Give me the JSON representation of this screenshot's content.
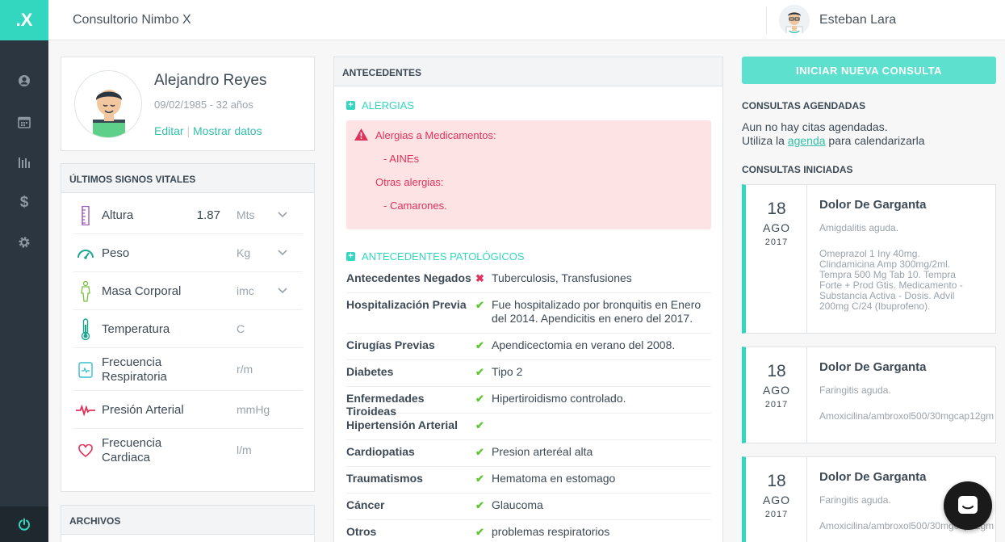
{
  "sidebar": {
    "logo": ".X"
  },
  "header": {
    "clinic_name": "Consultorio Nimbo X",
    "user_name": "Esteban Lara"
  },
  "patient": {
    "name": "Alejandro Reyes",
    "dob_age": "09/02/1985 - 32 años",
    "edit_label": "Editar",
    "separator": "|",
    "show_data_label": "Mostrar datos"
  },
  "vitals": {
    "title": "Últimos signos vitales",
    "items": [
      {
        "label": "Altura",
        "value": "1.87",
        "unit": "Mts",
        "icon": "ruler-icon"
      },
      {
        "label": "Peso",
        "value": "",
        "unit": "Kg",
        "icon": "scale-icon"
      },
      {
        "label": "Masa Corporal",
        "value": "",
        "unit": "imc",
        "icon": "body-icon"
      },
      {
        "label": "Temperatura",
        "value": "",
        "unit": "C",
        "icon": "thermometer-icon"
      },
      {
        "label": "Frecuencia Respiratoria",
        "value": "",
        "unit": "r/m",
        "icon": "lungs-monitor-icon"
      },
      {
        "label": "Presión Arterial",
        "value": "",
        "unit": "mmHg",
        "icon": "pulse-icon"
      },
      {
        "label": "Frecuencia Cardiaca",
        "value": "",
        "unit": "l/m",
        "icon": "heart-icon"
      }
    ]
  },
  "files": {
    "title": "Archivos"
  },
  "history": {
    "title": "Antecedentes",
    "allergies_title": "ALERGIAS",
    "allergy_med_title": "Alergias a Medicamentos:",
    "allergy_med_item": "- AINEs",
    "allergy_other_title": "Otras alergias:",
    "allergy_other_item": "- Camarones.",
    "pathological_title": "ANTECEDENTES PATOLÓGICOS",
    "rows": [
      {
        "label": "Antecedentes Negados",
        "mark": "✖",
        "value": "Tuberculosis, Transfusiones"
      },
      {
        "label": "Hospitalización Previa",
        "mark": "✔",
        "value": "Fue hospitalizado por bronquitis en Enero del 2014. Apendicitis en enero del 2017."
      },
      {
        "label": "Cirugías Previas",
        "mark": "✔",
        "value": "Apendicectomia en verano del 2008."
      },
      {
        "label": "Diabetes",
        "mark": "✔",
        "value": "Tipo 2"
      },
      {
        "label": "Enfermedades Tiroideas",
        "mark": "✔",
        "value": "Hipertiroidismo controlado."
      },
      {
        "label": "Hipertensión Arterial",
        "mark": "✔",
        "value": ""
      },
      {
        "label": "Cardiopatias",
        "mark": "✔",
        "value": "Presion arteréal alta"
      },
      {
        "label": "Traumatismos",
        "mark": "✔",
        "value": "Hematoma en estomago"
      },
      {
        "label": "Cáncer",
        "mark": "✔",
        "value": "Glaucoma"
      },
      {
        "label": "Otros",
        "mark": "✔",
        "value": "problemas respiratorios"
      }
    ]
  },
  "consults": {
    "new_button": "INICIAR NUEVA CONSULTA",
    "scheduled_title": "Consultas agendadas",
    "no_appts_line1": "Aun no hay citas agendadas.",
    "no_appts_pre": "Utiliza la",
    "no_appts_link": "agenda",
    "no_appts_post": "para calendarizarla",
    "started_title": "Consultas iniciadas",
    "items": [
      {
        "day": "18",
        "month": "AGO",
        "year": "2017",
        "title": "Dolor De Garganta",
        "diagnosis": "Amigdalitis aguda.",
        "rx": [
          "Omeprazol 1 Iny 40mg.",
          "Clindamicina Amp 300mg/2ml.",
          "Tempra 500 Mg Tab 10. Tempra",
          "Forte + Prod Gtis. Medicamento -",
          "Substancia Activa - Dosis. Advil",
          "200mg C/24 (Ibuprofeno)."
        ]
      },
      {
        "day": "18",
        "month": "AGO",
        "year": "2017",
        "title": "Dolor De Garganta",
        "diagnosis": "Faringitis aguda.",
        "rx": [
          "Amoxicilina/ambroxol500/30mgcap12gm"
        ]
      },
      {
        "day": "18",
        "month": "AGO",
        "year": "2017",
        "title": "Dolor De Garganta",
        "diagnosis": "Faringitis aguda.",
        "rx": [
          "Amoxicilina/ambroxol500/30mgcap12gm"
        ]
      }
    ]
  },
  "colors": {
    "accent": "#33d6bf",
    "sidebar": "#2b3640",
    "danger": "#e0335b",
    "success": "#5cc832"
  }
}
